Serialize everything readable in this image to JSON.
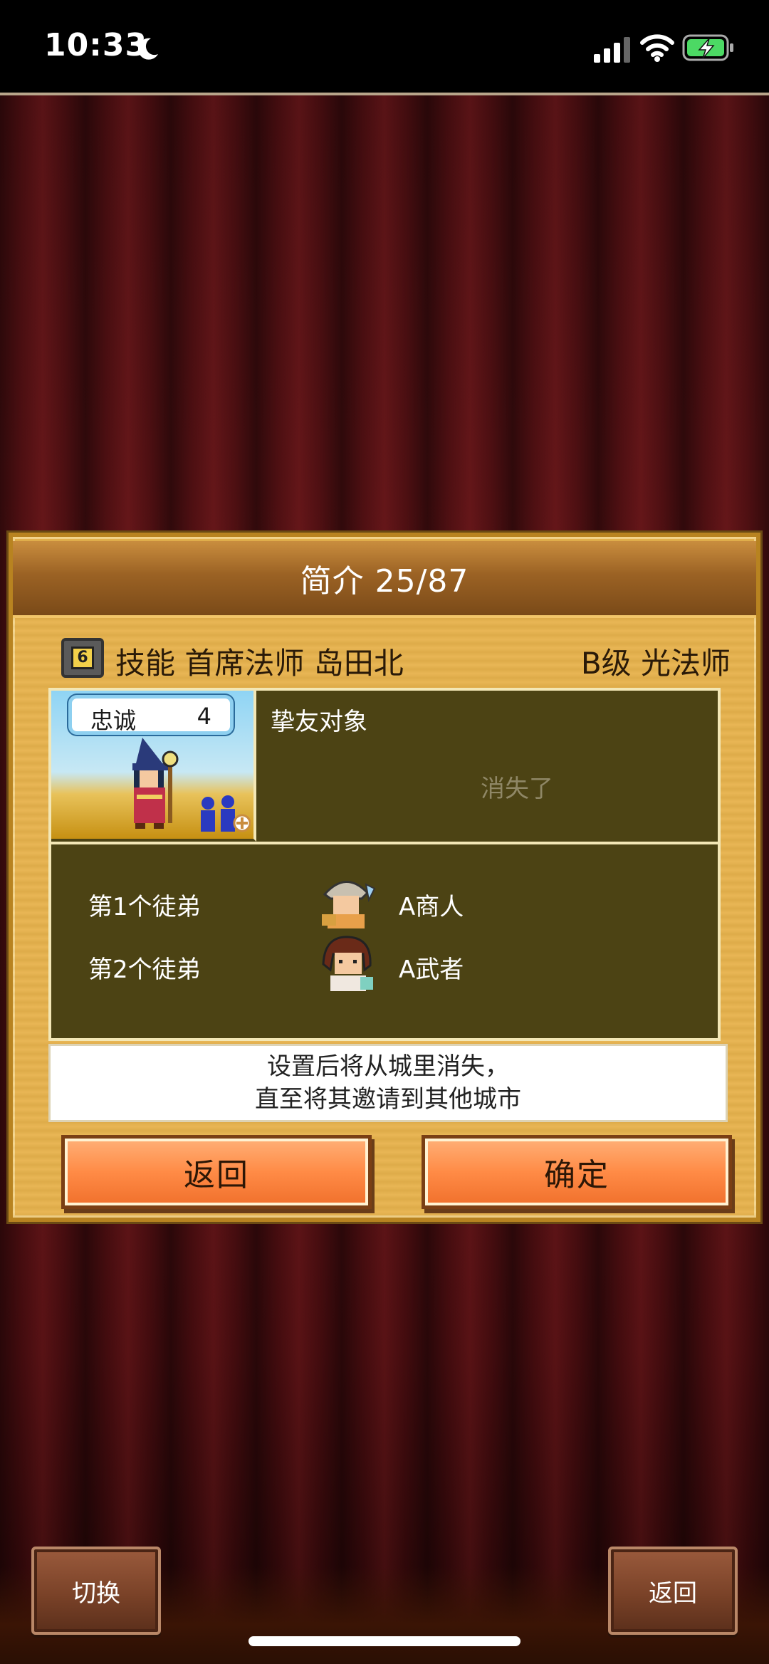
{
  "status_bar": {
    "time": "10:33",
    "icons": [
      "moon-icon",
      "signal-icon",
      "wifi-icon",
      "battery-charging-icon"
    ]
  },
  "dialog": {
    "title": "简介 25/87",
    "skill_line": "技能 首席法师 岛田北",
    "rank_line": "B级 光法师",
    "loyalty_label": "忠诚",
    "loyalty_value": "4",
    "friend_label": "挚友对象",
    "friend_status": "消失了",
    "apprentices": [
      {
        "label": "第1个徒弟",
        "name": "A商人"
      },
      {
        "label": "第2个徒弟",
        "name": "A武者"
      }
    ],
    "notice_line1": "设置后将从城里消失，",
    "notice_line2": "直至将其邀请到其他城市",
    "back_button": "返回",
    "confirm_button": "确定"
  },
  "bottom": {
    "switch_button": "切换",
    "back_button": "返回"
  },
  "colors": {
    "dialog_bg": "#e7b24c",
    "panel_bg": "#4c4314",
    "button_orange": "#ff8b46",
    "curtain": "#5e1316"
  }
}
